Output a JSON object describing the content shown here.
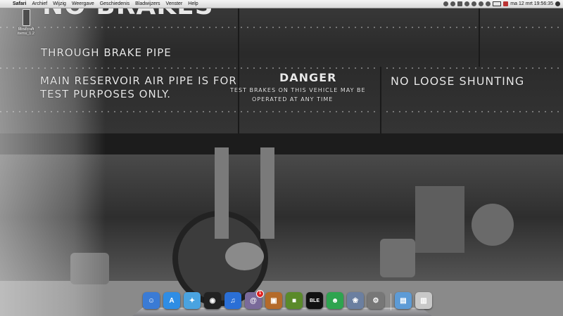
{
  "menubar": {
    "apple": "",
    "app_name": "Safari",
    "menus": [
      "Archief",
      "Wijzig",
      "Weergave",
      "Geschiedenis",
      "Bladwijzers",
      "Venster",
      "Help"
    ],
    "clock": "ma 12 mrt 19:56:35"
  },
  "desktop": {
    "icon_label": "Minecraft items_1.2",
    "wallpaper_text": {
      "top": "NO BRAKES",
      "line1": "THROUGH BRAKE PIPE",
      "line2": "MAIN RESERVOIR AIR PIPE IS FOR",
      "line3": "TEST PURPOSES ONLY.",
      "danger": "DANGER",
      "danger_sub1": "TEST BRAKES ON THIS VEHICLE MAY BE",
      "danger_sub2": "OPERATED AT ANY TIME",
      "right": "NO LOOSE SHUNTING"
    }
  },
  "dock": {
    "items": [
      {
        "name": "finder-icon",
        "glyph": "☺",
        "color": "#3a7bd5"
      },
      {
        "name": "app-store-icon",
        "glyph": "A",
        "color": "#2f8de4"
      },
      {
        "name": "safari-icon",
        "glyph": "✦",
        "color": "#4aa3e0"
      },
      {
        "name": "dashboard-icon",
        "glyph": "◉",
        "color": "#222"
      },
      {
        "name": "itunes-icon",
        "glyph": "♫",
        "color": "#2a6fd6"
      },
      {
        "name": "address-book-icon",
        "glyph": "@",
        "color": "#7a6a9a",
        "badge": "1"
      },
      {
        "name": "preview-icon",
        "glyph": "▣",
        "color": "#b46a2a"
      },
      {
        "name": "minecraft-icon",
        "glyph": "■",
        "color": "#5a8a2a"
      },
      {
        "name": "ble-icon",
        "glyph": "BLE",
        "color": "#111"
      },
      {
        "name": "messenger-icon",
        "glyph": "☻",
        "color": "#2ea44f"
      },
      {
        "name": "iphoto-icon",
        "glyph": "❀",
        "color": "#6b7fa0"
      },
      {
        "name": "system-preferences-icon",
        "glyph": "⚙",
        "color": "#777"
      },
      {
        "name": "applications-folder-icon",
        "glyph": "▤",
        "color": "#5d9bd6"
      },
      {
        "name": "trash-icon",
        "glyph": "▥",
        "color": "#c8c8c8"
      }
    ]
  }
}
